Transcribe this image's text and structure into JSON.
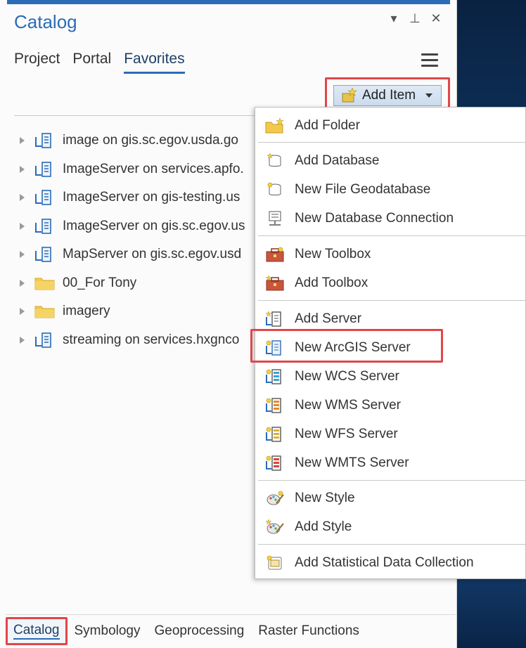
{
  "pane": {
    "title": "Catalog",
    "controls": [
      "▾",
      "⊥",
      "✕"
    ]
  },
  "tabs": [
    {
      "label": "Project",
      "active": false
    },
    {
      "label": "Portal",
      "active": false
    },
    {
      "label": "Favorites",
      "active": true
    }
  ],
  "toolbar": {
    "add_item_label": "Add Item"
  },
  "tree": [
    {
      "label": "image on gis.sc.egov.usda.go",
      "icon": "server-icon"
    },
    {
      "label": "ImageServer on services.apfo.",
      "icon": "server-icon"
    },
    {
      "label": "ImageServer on gis-testing.us",
      "icon": "server-icon"
    },
    {
      "label": "ImageServer on gis.sc.egov.us",
      "icon": "server-icon"
    },
    {
      "label": "MapServer on gis.sc.egov.usd",
      "icon": "server-icon"
    },
    {
      "label": "00_For Tony",
      "icon": "folder-icon"
    },
    {
      "label": "imagery",
      "icon": "folder-icon"
    },
    {
      "label": "streaming on services.hxgnco",
      "icon": "server-icon"
    }
  ],
  "menu": {
    "items": [
      {
        "label": "Add Folder",
        "icon": "add-folder-icon"
      },
      {
        "label": "Add Database",
        "icon": "add-database-icon"
      },
      {
        "label": "New File Geodatabase",
        "icon": "new-geodatabase-icon"
      },
      {
        "label": "New Database Connection",
        "icon": "database-connection-icon"
      },
      {
        "label": "New Toolbox",
        "icon": "new-toolbox-icon"
      },
      {
        "label": "Add Toolbox",
        "icon": "add-toolbox-icon"
      },
      {
        "label": "Add Server",
        "icon": "add-server-icon"
      },
      {
        "label": "New ArcGIS Server",
        "icon": "new-arcgis-server-icon"
      },
      {
        "label": "New WCS Server",
        "icon": "new-wcs-server-icon"
      },
      {
        "label": "New WMS Server",
        "icon": "new-wms-server-icon"
      },
      {
        "label": "New WFS Server",
        "icon": "new-wfs-server-icon"
      },
      {
        "label": "New WMTS Server",
        "icon": "new-wmts-server-icon"
      },
      {
        "label": "New Style",
        "icon": "new-style-icon"
      },
      {
        "label": "Add Style",
        "icon": "add-style-icon"
      },
      {
        "label": "Add Statistical Data Collection",
        "icon": "statistical-data-icon"
      }
    ]
  },
  "bottom_tabs": [
    {
      "label": "Catalog",
      "active": true
    },
    {
      "label": "Symbology",
      "active": false
    },
    {
      "label": "Geoprocessing",
      "active": false
    },
    {
      "label": "Raster Functions",
      "active": false
    }
  ],
  "colors": {
    "accent": "#2b6cb7",
    "highlight_box": "#e0474a"
  }
}
